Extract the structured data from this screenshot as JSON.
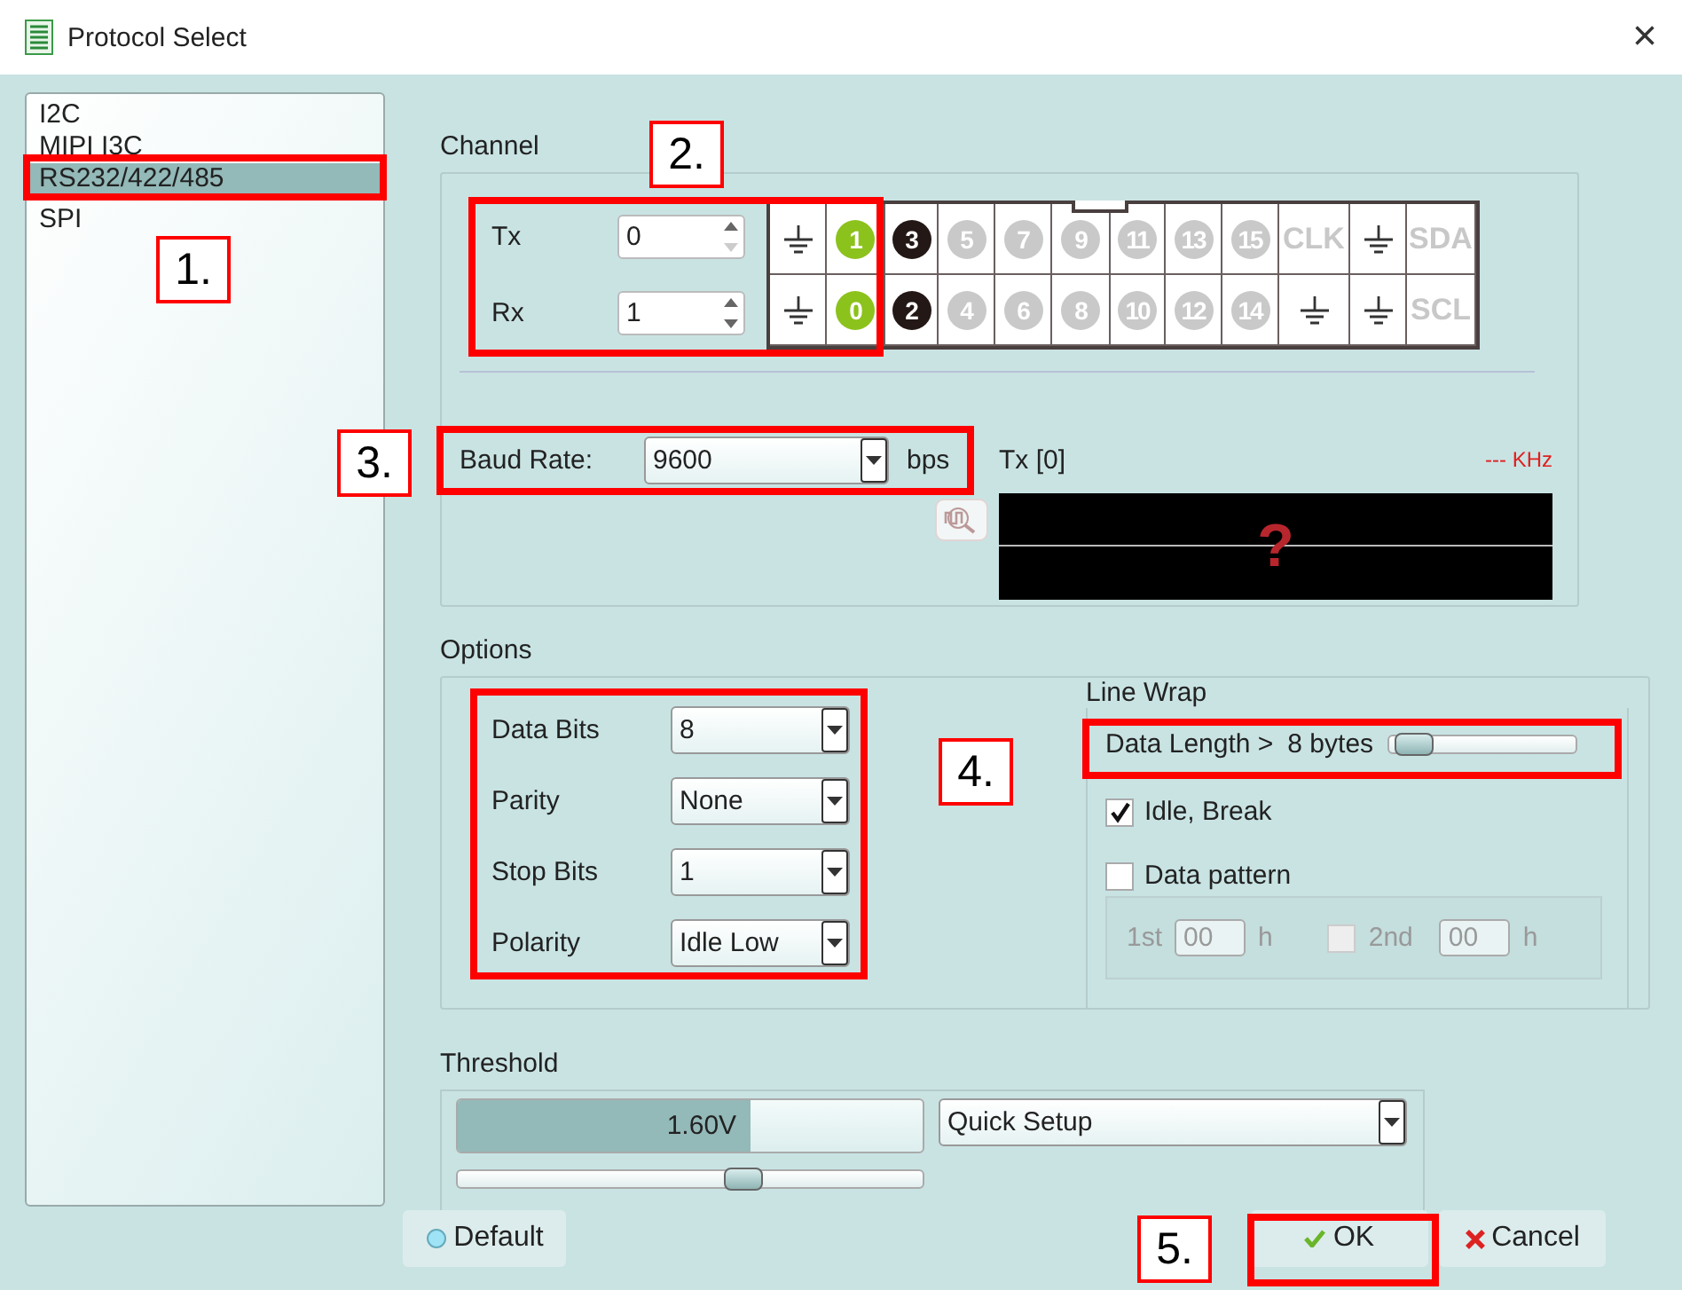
{
  "window": {
    "title": "Protocol Select",
    "close": "×"
  },
  "protocols": [
    {
      "label": "I2C",
      "selected": false
    },
    {
      "label": "MIPI I3C",
      "selected": false
    },
    {
      "label": "RS232/422/485",
      "selected": true
    },
    {
      "label": "SPI",
      "selected": false
    }
  ],
  "channel": {
    "title": "Channel",
    "tx_label": "Tx",
    "tx_value": "0",
    "rx_label": "Rx",
    "rx_value": "1",
    "pins_top": [
      {
        "kind": "ground"
      },
      {
        "kind": "pin",
        "text": "1",
        "color": "#8cc21c"
      },
      {
        "kind": "pin",
        "text": "3",
        "color": "#231815"
      },
      {
        "kind": "pin",
        "text": "5",
        "color": "#c9c9c9"
      },
      {
        "kind": "pin",
        "text": "7",
        "color": "#c9c9c9"
      },
      {
        "kind": "pin",
        "text": "9",
        "color": "#c9c9c9"
      },
      {
        "kind": "pin",
        "text": "11",
        "color": "#c9c9c9"
      },
      {
        "kind": "pin",
        "text": "13",
        "color": "#c9c9c9"
      },
      {
        "kind": "pin",
        "text": "15",
        "color": "#c9c9c9"
      },
      {
        "kind": "label",
        "text": "CLK"
      },
      {
        "kind": "ground"
      },
      {
        "kind": "label",
        "text": "SDA"
      }
    ],
    "pins_bottom": [
      {
        "kind": "ground"
      },
      {
        "kind": "pin",
        "text": "0",
        "color": "#8cc21c"
      },
      {
        "kind": "pin",
        "text": "2",
        "color": "#231815"
      },
      {
        "kind": "pin",
        "text": "4",
        "color": "#c9c9c9"
      },
      {
        "kind": "pin",
        "text": "6",
        "color": "#c9c9c9"
      },
      {
        "kind": "pin",
        "text": "8",
        "color": "#c9c9c9"
      },
      {
        "kind": "pin",
        "text": "10",
        "color": "#c9c9c9"
      },
      {
        "kind": "pin",
        "text": "12",
        "color": "#c9c9c9"
      },
      {
        "kind": "pin",
        "text": "14",
        "color": "#c9c9c9"
      },
      {
        "kind": "ground"
      },
      {
        "kind": "ground"
      },
      {
        "kind": "label",
        "text": "SCL"
      }
    ],
    "baud_label": "Baud Rate:",
    "baud_value": "9600",
    "baud_unit": "bps",
    "scope_title": "Tx [0]",
    "frequency": "--- KHz",
    "scope_glyph": "?"
  },
  "options": {
    "title": "Options",
    "fields": [
      {
        "label": "Data Bits",
        "value": "8"
      },
      {
        "label": "Parity",
        "value": "None"
      },
      {
        "label": "Stop Bits",
        "value": "1"
      },
      {
        "label": "Polarity",
        "value": "Idle Low"
      }
    ],
    "line_wrap": {
      "title": "Line Wrap",
      "data_length_label": "Data Length >",
      "data_length_value": "8 bytes",
      "level": 0.03,
      "idle_break": {
        "label": "Idle, Break",
        "checked": true
      },
      "data_pattern": {
        "label": "Data pattern",
        "checked": false
      },
      "first_label": "1st",
      "first_value": "00",
      "first_unit": "h",
      "second": {
        "label": "2nd",
        "checked": false
      },
      "second_value": "00",
      "second_unit": "h"
    }
  },
  "threshold": {
    "title": "Threshold",
    "value": "1.60V",
    "level": 0.63,
    "slider": {
      "level": 0.62
    },
    "preset": "Quick Setup"
  },
  "buttons": {
    "default": "Default",
    "ok": "OK",
    "cancel": "Cancel"
  },
  "annotations": [
    {
      "label": "1."
    },
    {
      "label": "2."
    },
    {
      "label": "3."
    },
    {
      "label": "4."
    },
    {
      "label": "5."
    }
  ]
}
